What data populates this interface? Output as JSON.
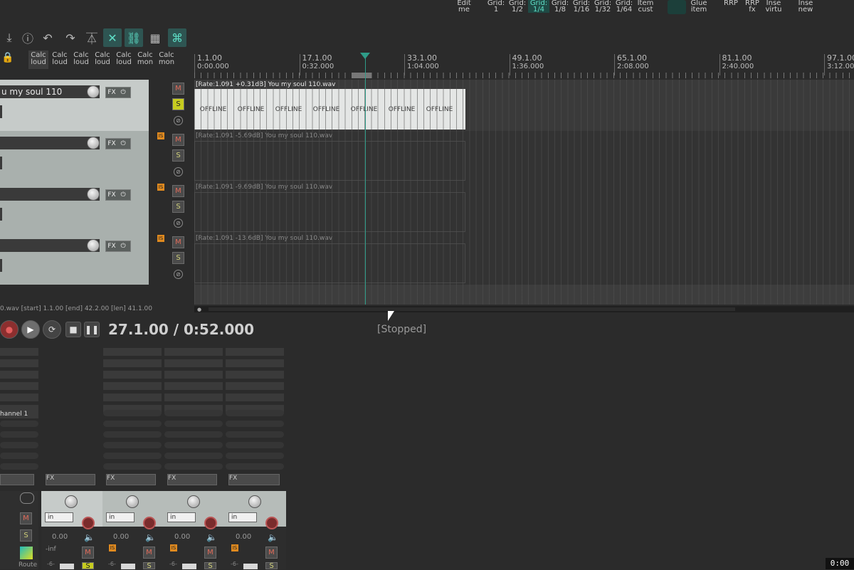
{
  "top_actions": [
    {
      "l1": "Edit",
      "l2": "me"
    },
    {
      "l1": "Grid:",
      "l2": "1"
    },
    {
      "l1": "Grid:",
      "l2": "1/2"
    },
    {
      "l1": "Grid:",
      "l2": "1/4",
      "active": true
    },
    {
      "l1": "Grid:",
      "l2": "1/8"
    },
    {
      "l1": "Grid:",
      "l2": "1/16"
    },
    {
      "l1": "Grid:",
      "l2": "1/32"
    },
    {
      "l1": "Grid:",
      "l2": "1/64"
    },
    {
      "l1": "Item",
      "l2": "cust"
    }
  ],
  "top_actions_right": [
    {
      "l1": "Glue",
      "l2": "item"
    },
    {
      "l1": "RRP",
      "l2": ""
    },
    {
      "l1": "RRP",
      "l2": "fx"
    },
    {
      "l1": "Inse",
      "l2": "virtu"
    },
    {
      "l1": "Inse",
      "l2": "new"
    }
  ],
  "calc_buttons": [
    {
      "l1": "Calc",
      "l2": "loud",
      "active": true
    },
    {
      "l1": "Calc",
      "l2": "loud"
    },
    {
      "l1": "Calc",
      "l2": "loud"
    },
    {
      "l1": "Calc",
      "l2": "loud"
    },
    {
      "l1": "Calc",
      "l2": "loud"
    },
    {
      "l1": "Calc",
      "l2": "mon"
    },
    {
      "l1": "Calc",
      "l2": "mon"
    }
  ],
  "ruler": [
    {
      "bar": "1.1.00",
      "time": "0:00.000"
    },
    {
      "bar": "17.1.00",
      "time": "0:32.000"
    },
    {
      "bar": "33.1.00",
      "time": "1:04.000"
    },
    {
      "bar": "49.1.00",
      "time": "1:36.000"
    },
    {
      "bar": "65.1.00",
      "time": "2:08.000"
    },
    {
      "bar": "81.1.00",
      "time": "2:40.000"
    },
    {
      "bar": "97.1.00",
      "time": "3:12.000"
    }
  ],
  "tracks": [
    {
      "name": "u my soul 110",
      "item_label": "[Rate:1.091 +0.31dB] You my soul 110.wav"
    },
    {
      "name": "",
      "item_label": "[Rate:1.091 -5.69dB] You my soul 110.wav"
    },
    {
      "name": "",
      "item_label": "[Rate:1.091 -9.69dB] You my soul 110.wav"
    },
    {
      "name": "",
      "item_label": "[Rate:1.091 -13.6dB] You my soul 110.wav"
    }
  ],
  "offline_text": [
    "OFFLINE",
    "OFFLINE",
    "OFFLINE",
    "OFFLINE",
    "OFFLINE",
    "OFFLINE",
    "OFFLINE",
    "O"
  ],
  "buttons": {
    "fx": "FX",
    "mute": "M",
    "solo": "S",
    "phase": "⊘",
    "is": "IS"
  },
  "status_line": "0.wav [start] 1.1.00 [end] 42.2.00 [len] 41.1.00",
  "transport": {
    "position": "27.1.00 / 0:52.000",
    "state": "[Stopped]"
  },
  "mixer": {
    "partial_label": "hannel 1",
    "strips": [
      {
        "in": "in",
        "vol": "0.00",
        "level": "-inf",
        "scale": "-6-"
      },
      {
        "in": "in",
        "vol": "0.00",
        "scale": "-6-"
      },
      {
        "in": "in",
        "vol": "0.00",
        "scale": "-6-"
      },
      {
        "in": "in",
        "vol": "0.00",
        "scale": "-6-"
      }
    ],
    "route": "Route"
  },
  "timecode": "0:00"
}
